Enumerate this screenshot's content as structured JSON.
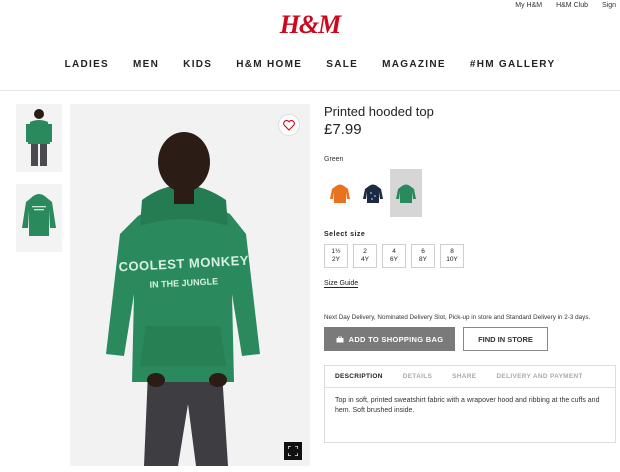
{
  "top_links": [
    "My H&M",
    "H&M Club",
    "Sign"
  ],
  "brand": "H&M",
  "nav": [
    "LADIES",
    "MEN",
    "KIDS",
    "H&M HOME",
    "SALE",
    "MAGAZINE",
    "#HM GALLERY"
  ],
  "product": {
    "title": "Printed hooded top",
    "price": "£7.99",
    "color_label": "Green",
    "hoodie_print_line1": "COOLEST MONKEY",
    "hoodie_print_line2": "IN THE JUNGLE",
    "swatches": [
      {
        "name": "orange",
        "color": "#e8731c"
      },
      {
        "name": "navy",
        "color": "#1d2a44"
      },
      {
        "name": "green",
        "color": "#2a8a5d",
        "selected": true
      }
    ],
    "size_label": "Select size",
    "sizes": [
      [
        "1½",
        "2Y"
      ],
      [
        "2",
        "4Y"
      ],
      [
        "4",
        "6Y"
      ],
      [
        "6",
        "8Y"
      ],
      [
        "8",
        "10Y"
      ]
    ],
    "size_guide": "Size Guide",
    "delivery_text": "Next Day Delivery, Nominated Delivery Slot, Pick-up in store and Standard Delivery in 2-3 days.",
    "add_to_bag": "ADD TO SHOPPING BAG",
    "find_in_store": "FIND IN STORE",
    "tabs": [
      "DESCRIPTION",
      "DETAILS",
      "SHARE",
      "DELIVERY AND PAYMENT"
    ],
    "description": "Top in soft, printed sweatshirt fabric with a wrapover hood and ribbing at the cuffs and hem. Soft brushed inside."
  },
  "colors": {
    "brand_red": "#cc071e",
    "hoodie_green": "#2a8a5d",
    "button_grey": "#7a7a7a"
  }
}
